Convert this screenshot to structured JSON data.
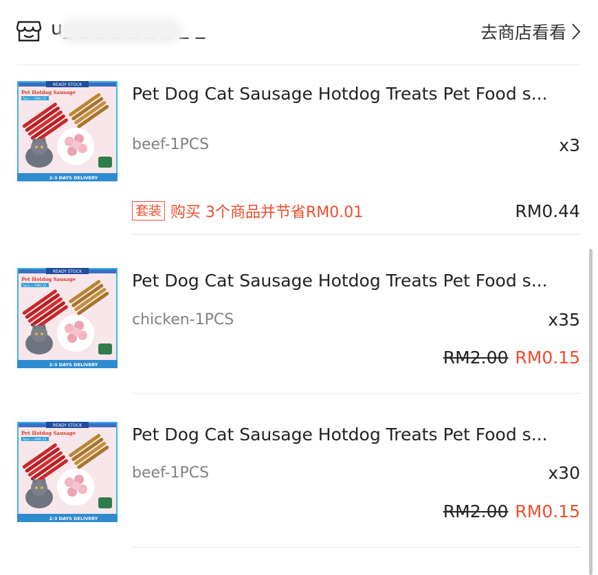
{
  "shop": {
    "name": "u_ _ _ _ _ _ _ _ _",
    "visit_label": "去商店看看"
  },
  "items": [
    {
      "title": "Pet Dog Cat Sausage  Hotdog Treats Pet Food s...",
      "variant": "beef-1PCS",
      "quantity": "x3",
      "price": "RM0.44",
      "bundle_tag": "套装",
      "bundle_text": "购买 3个商品并节省RM0.01"
    },
    {
      "title": "Pet Dog Cat Sausage  Hotdog Treats Pet Food s...",
      "variant": "chicken-1PCS",
      "quantity": "x35",
      "original_price": "RM2.00",
      "price": "RM0.15"
    },
    {
      "title": "Pet Dog Cat Sausage  Hotdog Treats Pet Food s...",
      "variant": "beef-1PCS",
      "quantity": "x30",
      "original_price": "RM2.00",
      "price": "RM0.15"
    }
  ],
  "thumbnail": {
    "banner": "READY STOCK",
    "heading": "Pet Hotdog Sausage",
    "badge": "5pcs = RM0.15",
    "footer": "2-3 DAYS DELIVERY"
  },
  "colors": {
    "accent": "#ee4d2d",
    "text": "#222222",
    "muted": "#808080",
    "divider": "#e7e7e7"
  }
}
